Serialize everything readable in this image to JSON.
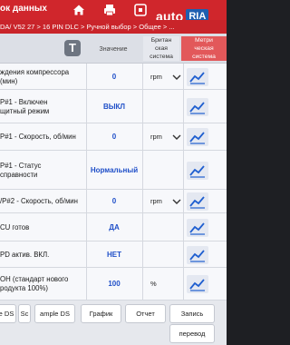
{
  "header": {
    "title": "ок данных",
    "breadcrumb": "DA/ V52 27 > 16 PIN DLC > Ручной выбор > Общее > ..."
  },
  "logo": {
    "text": "auto",
    "badge": "RIA"
  },
  "columns": {
    "value": "Значение",
    "unit_lines": [
      "Британ",
      "ская",
      "система"
    ],
    "metric_lines": [
      "Метри",
      "ческая",
      "система"
    ]
  },
  "rows": [
    {
      "name_lines": [
        "ждения компрессора",
        "(мин)"
      ],
      "value": "0",
      "unit": "rpm",
      "has_dropdown": true
    },
    {
      "name_lines": [
        "P#1 - Включен",
        "щитный режим"
      ],
      "value": "ВЫКЛ",
      "unit": "",
      "has_dropdown": false
    },
    {
      "name_lines": [
        "P#1 - Скорость, об/мин"
      ],
      "value": "0",
      "unit": "rpm",
      "has_dropdown": true
    },
    {
      "name_lines": [
        "P#1 - Статус",
        "справности"
      ],
      "value": "Нормальный",
      "unit": "",
      "has_dropdown": false
    },
    {
      "name_lines": [
        "/P#2 - Скорость, об/мин"
      ],
      "value": "0",
      "unit": "rpm",
      "has_dropdown": true
    },
    {
      "name_lines": [
        "CU готов"
      ],
      "value": "ДА",
      "unit": "",
      "has_dropdown": false
    },
    {
      "name_lines": [
        "PD актив. ВКЛ."
      ],
      "value": "НЕТ",
      "unit": "",
      "has_dropdown": false
    },
    {
      "name_lines": [
        "ОН (стандарт нового",
        "родукта 100%)"
      ],
      "value": "100",
      "unit": "%",
      "has_dropdown": false
    }
  ],
  "bottom": {
    "btn_ds": "e DS",
    "btn_s": "Sc",
    "btn_sample": "ample DS",
    "btn_graph": "График",
    "btn_report": "Отчет",
    "btn_record": "Запись",
    "btn_translate": "перевод"
  },
  "colors": {
    "header": "#d0262c",
    "value": "#1f4fc8",
    "metric": "#e2585a",
    "graph_icon": "#1f5fd0"
  }
}
